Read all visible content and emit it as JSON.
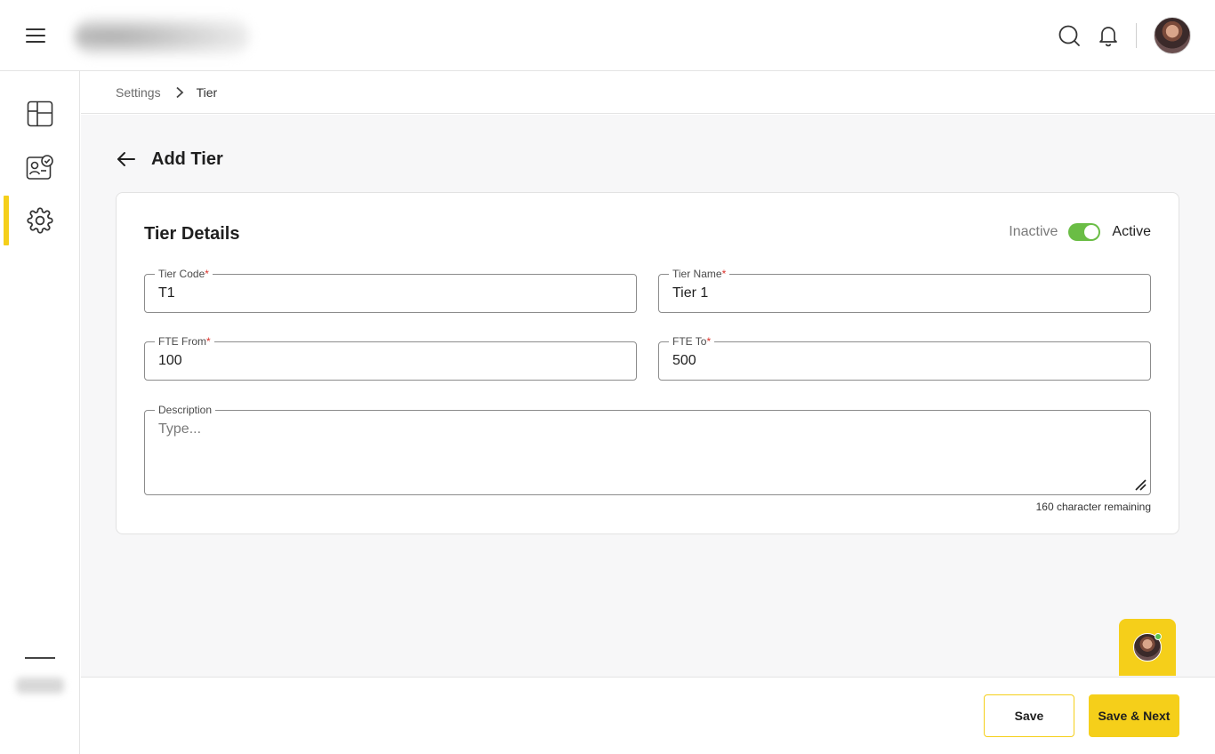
{
  "header": {
    "menu_icon": "hamburger-icon",
    "search_icon": "search-icon",
    "notification_icon": "bell-icon"
  },
  "sidebar": {
    "items": [
      {
        "icon": "layout-grid-icon",
        "active": false
      },
      {
        "icon": "profile-check-icon",
        "active": false
      },
      {
        "icon": "gear-icon",
        "active": true
      }
    ]
  },
  "breadcrumb": {
    "parent": "Settings",
    "current": "Tier"
  },
  "page": {
    "title": "Add Tier"
  },
  "form": {
    "title": "Tier Details",
    "status": {
      "inactive_label": "Inactive",
      "active_label": "Active",
      "is_active": true
    },
    "tier_code": {
      "label": "Tier Code",
      "required_mark": "*",
      "value": "T1"
    },
    "tier_name": {
      "label": "Tier Name",
      "required_mark": "*",
      "value": "Tier 1"
    },
    "fte_from": {
      "label": "FTE From",
      "required_mark": "*",
      "value": "100"
    },
    "fte_to": {
      "label": "FTE To",
      "required_mark": "*",
      "value": "500"
    },
    "description": {
      "label": "Description",
      "placeholder": "Type...",
      "value": ""
    },
    "char_remaining": "160 character remaining"
  },
  "footer": {
    "save_label": "Save",
    "save_next_label": "Save & Next"
  },
  "colors": {
    "accent": "#f5cf1a",
    "toggle_on": "#6abd45",
    "required": "#d9322b"
  }
}
